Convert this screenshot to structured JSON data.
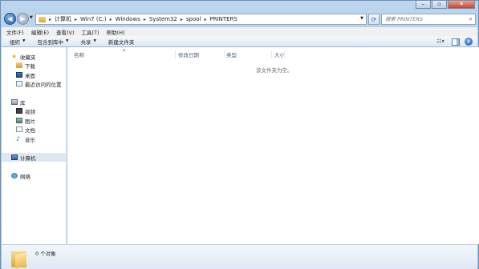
{
  "caption": {
    "minimize": "–",
    "maximize": "▫",
    "close": "✕"
  },
  "address": {
    "crumbs": [
      "计算机",
      "Win7 (C:)",
      "Windows",
      "System32",
      "spool",
      "PRINTERS"
    ],
    "search_placeholder": "搜索 PRINTERS"
  },
  "menu": [
    "文件(F)",
    "编辑(E)",
    "查看(V)",
    "工具(T)",
    "帮助(H)"
  ],
  "toolbar": {
    "organize": "组织",
    "include_library": "包含到库中",
    "share": "共享",
    "new_folder": "新建文件夹"
  },
  "nav": {
    "favorites": "收藏夹",
    "downloads": "下载",
    "desktop": "桌面",
    "recent": "最近访问的位置",
    "libraries": "库",
    "videos": "视频",
    "pictures": "图片",
    "documents": "文档",
    "music": "音乐",
    "computer": "计算机",
    "network": "网络"
  },
  "columns": {
    "name": "名称",
    "date": "修改日期",
    "type": "类型",
    "size": "大小"
  },
  "content": {
    "empty_message": "该文件夹为空。"
  },
  "status": {
    "items": "0 个对象"
  }
}
